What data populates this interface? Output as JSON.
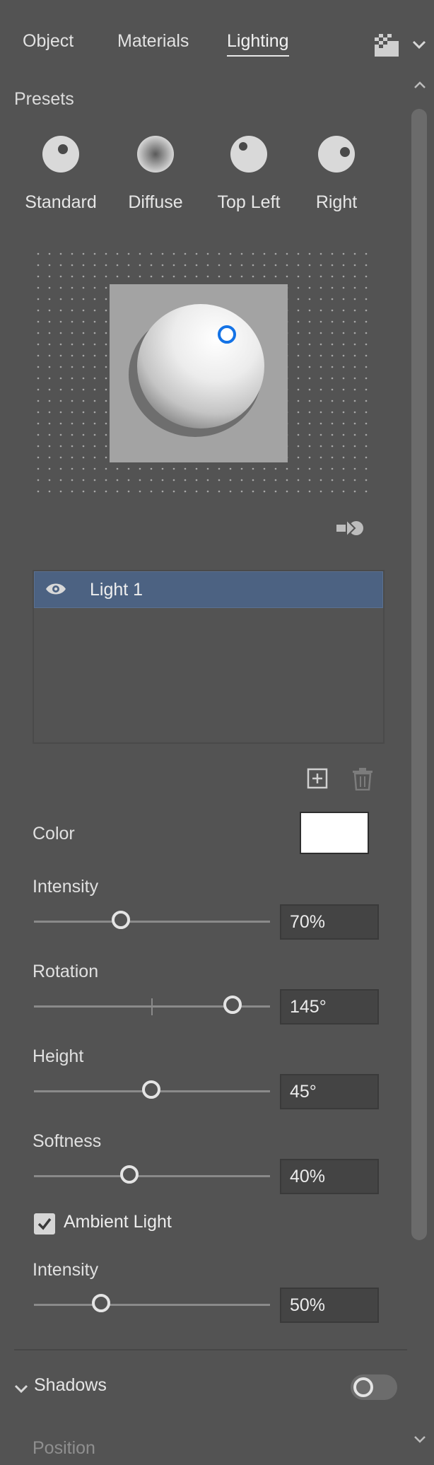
{
  "tabs": [
    {
      "label": "Object",
      "active": false
    },
    {
      "label": "Materials",
      "active": false
    },
    {
      "label": "Lighting",
      "active": true
    }
  ],
  "panel_menu_icon": "panel-options-icon",
  "presets": {
    "heading": "Presets",
    "items": [
      {
        "label": "Standard",
        "icon": "sphere-standard-icon"
      },
      {
        "label": "Diffuse",
        "icon": "sphere-diffuse-icon"
      },
      {
        "label": "Top Left",
        "icon": "sphere-top-left-icon"
      },
      {
        "label": "Right",
        "icon": "sphere-right-icon"
      }
    ]
  },
  "lights": {
    "items": [
      {
        "name": "Light 1",
        "selected": true,
        "visible": true
      }
    ]
  },
  "properties": {
    "color_label": "Color",
    "color_value": "#ffffff",
    "intensity": {
      "label": "Intensity",
      "value": "70%",
      "fraction": 0.36
    },
    "rotation": {
      "label": "Rotation",
      "value": "145°",
      "fraction": 0.87
    },
    "height": {
      "label": "Height",
      "value": "45°",
      "fraction": 0.5
    },
    "softness": {
      "label": "Softness",
      "value": "40%",
      "fraction": 0.4
    },
    "ambient_light": {
      "label": "Ambient Light",
      "checked": true
    },
    "ambient_intensity": {
      "label": "Intensity",
      "value": "50%",
      "fraction": 0.27
    }
  },
  "shadows": {
    "label": "Shadows",
    "enabled": false,
    "next_label": "Position"
  },
  "colors": {
    "panel_bg": "#535353",
    "selection": "#4c6282",
    "handle": "#1473e6"
  }
}
